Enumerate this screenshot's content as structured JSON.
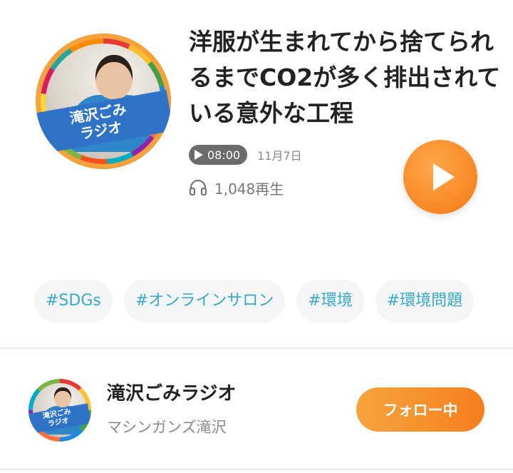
{
  "episode": {
    "cover_banner": "滝沢ごみ\nラジオ",
    "title": "洋服が生まれてから捨てられるまでCO2が多く排出されている意外な工程",
    "duration": "08:00",
    "date": "11月7日",
    "plays": "1,048再生",
    "play_icon": "play-icon",
    "headphones_icon": "headphones-icon"
  },
  "tags": [
    "#SDGs",
    "#オンラインサロン",
    "#環境",
    "#環境問題"
  ],
  "channel": {
    "name": "滝沢ごみラジオ",
    "owner": "マシンガンズ滝沢",
    "follow_label": "フォロー中",
    "avatar_banner": "滝沢ごみ\nラジオ"
  },
  "colors": {
    "accent_orange": "#f68b1f",
    "tag_text": "#3aa8c7",
    "badge_gray": "#6b6b6b"
  }
}
